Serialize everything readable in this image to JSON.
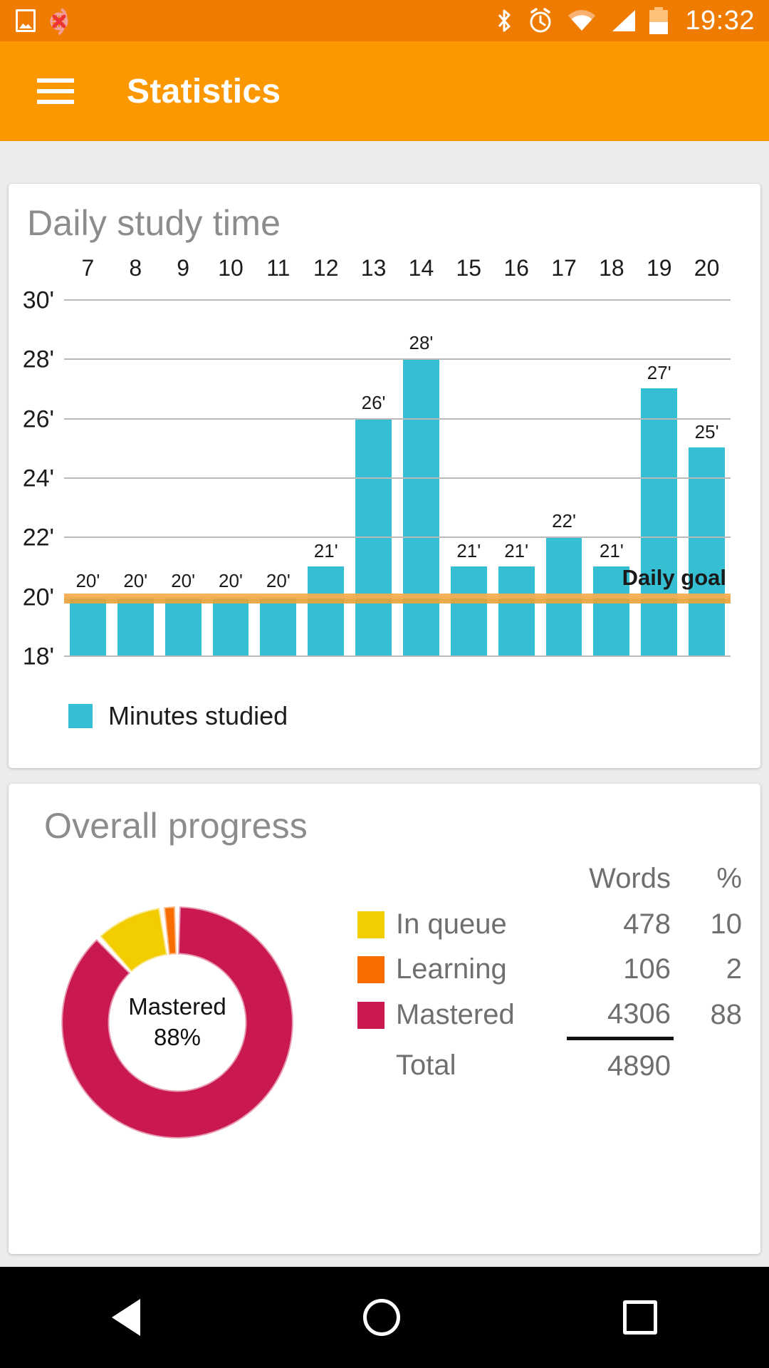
{
  "statusbar": {
    "time": "19:32",
    "icons": [
      "photo-icon",
      "no-globe-icon",
      "bluetooth-icon",
      "alarm-icon",
      "wifi-icon",
      "signal-icon",
      "battery-icon"
    ]
  },
  "appbar": {
    "menu_icon": "hamburger-menu-icon",
    "title": "Statistics"
  },
  "daily_card": {
    "title": "Daily study time",
    "legend_label": "Minutes studied",
    "goal_label": "Daily goal"
  },
  "overall_card": {
    "title": "Overall progress",
    "donut_center_line1": "Mastered",
    "donut_center_line2": "88%",
    "header_words": "Words",
    "header_pct": "%",
    "rows": [
      {
        "label": "In queue",
        "words": "478",
        "pct": "10",
        "color": "#f2cd00"
      },
      {
        "label": "Learning",
        "words": "106",
        "pct": "2",
        "color": "#f96c00"
      },
      {
        "label": "Mastered",
        "words": "4306",
        "pct": "88",
        "color": "#c9194f"
      }
    ],
    "total_label": "Total",
    "total_words": "4890"
  },
  "navbar": {
    "back": "back-triangle-icon",
    "home": "home-circle-icon",
    "recents": "recents-square-icon"
  },
  "chart_data": {
    "type": "bar",
    "title": "Daily study time",
    "xlabel": "",
    "ylabel": "",
    "categories": [
      "7",
      "8",
      "9",
      "10",
      "11",
      "12",
      "13",
      "14",
      "15",
      "16",
      "17",
      "18",
      "19",
      "20"
    ],
    "values": [
      20,
      20,
      20,
      20,
      20,
      21,
      26,
      28,
      21,
      21,
      22,
      21,
      27,
      25
    ],
    "value_labels": [
      "20'",
      "20'",
      "20'",
      "20'",
      "20'",
      "21'",
      "26'",
      "28'",
      "21'",
      "21'",
      "22'",
      "21'",
      "27'",
      "25'"
    ],
    "ytick_labels": [
      "18'",
      "20'",
      "22'",
      "24'",
      "26'",
      "28'",
      "30'"
    ],
    "yticks": [
      18,
      20,
      22,
      24,
      26,
      28,
      30
    ],
    "ylim": [
      18,
      30
    ],
    "grid": true,
    "series": [
      {
        "name": "Minutes studied",
        "color": "#35bfd2",
        "values": [
          20,
          20,
          20,
          20,
          20,
          21,
          26,
          28,
          21,
          21,
          22,
          21,
          27,
          25
        ]
      }
    ],
    "goal_line": {
      "label": "Daily goal",
      "value": 20,
      "color": "#e8a33a"
    },
    "legend": {
      "position": "bottom-left",
      "entries": [
        "Minutes studied"
      ]
    }
  },
  "donut_data": {
    "type": "pie",
    "title": "Overall progress",
    "labels": [
      "Mastered",
      "In queue",
      "Learning"
    ],
    "values": [
      4306,
      478,
      106
    ],
    "percents": [
      88,
      10,
      2
    ],
    "colors": [
      "#c9194f",
      "#f2cd00",
      "#f96c00"
    ],
    "total": 4890,
    "center_label": "Mastered 88%"
  },
  "colors": {
    "status_bar": "#ef7c00",
    "app_bar": "#fb9800",
    "bar_series": "#35bfd2",
    "goal_line": "#e8a33a",
    "mastered": "#c9194f",
    "in_queue": "#f2cd00",
    "learning": "#f96c00"
  }
}
